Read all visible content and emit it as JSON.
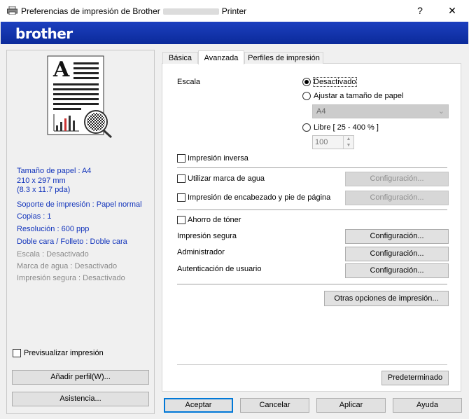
{
  "window": {
    "title_prefix": "Preferencias de impresión de Brother",
    "title_suffix": "Printer",
    "help_glyph": "?",
    "close_glyph": "✕"
  },
  "brand": {
    "logo": "brother"
  },
  "preview_panel": {
    "info_paper": "Tamaño de papel : A4",
    "info_dims": "210 x 297 mm",
    "info_dims_in": "(8.3 x 11.7 pda)",
    "info_media": "Soporte de impresión : Papel normal",
    "info_copies": "Copias : 1",
    "info_resolution": "Resolución : 600 ppp",
    "info_duplex": "Doble cara / Folleto : Doble cara",
    "info_scale": "Escala : Desactivado",
    "info_watermark": "Marca de agua : Desactivado",
    "info_secure": "Impresión segura : Desactivado",
    "preview_checkbox": "Previsualizar impresión",
    "add_profile_button": "Añadir perfil(W)...",
    "support_button": "Asistencia..."
  },
  "tabs": {
    "basic": "Básica",
    "advanced": "Avanzada",
    "profiles": "Perfiles de impresión"
  },
  "advanced": {
    "scale_label": "Escala",
    "scale_off": "Desactivado",
    "scale_fit": "Ajustar a tamaño de papel",
    "paper_select": "A4",
    "scale_free": "Libre [ 25 - 400 % ]",
    "free_value": "100",
    "reverse_print": "Impresión inversa",
    "watermark": "Utilizar marca de agua",
    "header_footer": "Impresión de encabezado y pie de página",
    "toner_save": "Ahorro de tóner",
    "secure_print": "Impresión segura",
    "administrator": "Administrador",
    "user_auth": "Autenticación de usuario",
    "config_button": "Configuración...",
    "other_options": "Otras opciones de impresión...",
    "default_button": "Predeterminado"
  },
  "footer": {
    "accept": "Aceptar",
    "cancel": "Cancelar",
    "apply": "Aplicar",
    "help": "Ayuda"
  }
}
